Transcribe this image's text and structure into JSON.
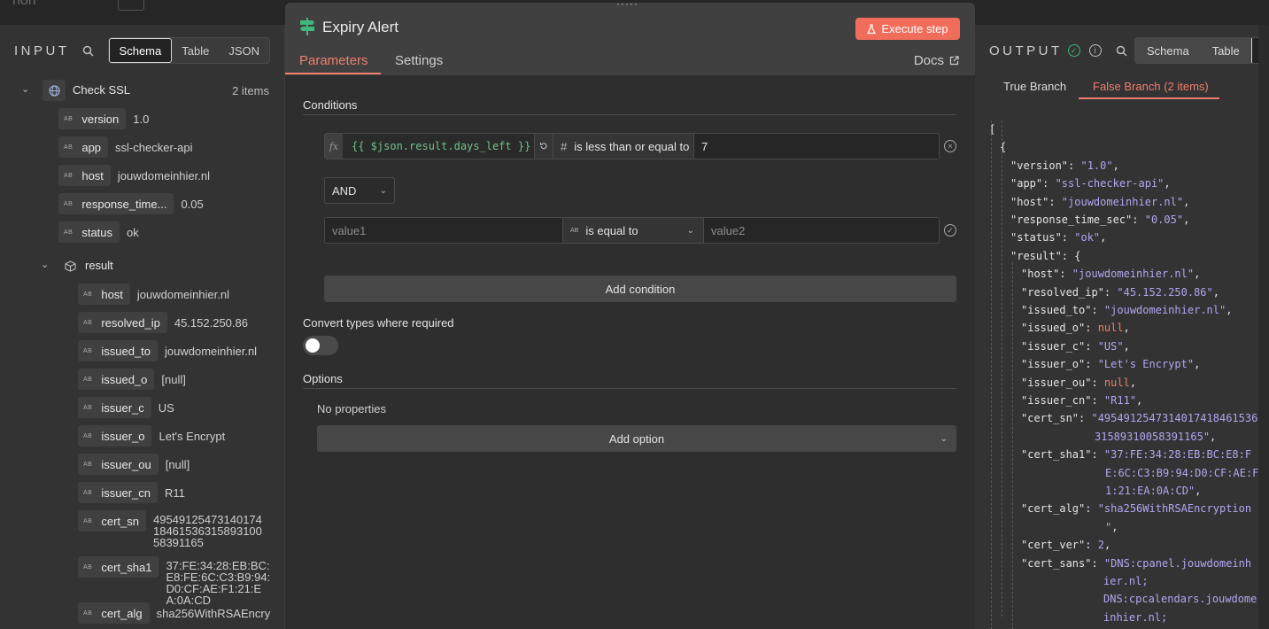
{
  "background": {
    "node_label": "non"
  },
  "input": {
    "label": "INPUT",
    "view_tabs": [
      "Schema",
      "Table",
      "JSON"
    ],
    "active_view": "Schema",
    "root": {
      "label": "Check SSL",
      "count": "2 items"
    },
    "fields": [
      {
        "key": "version",
        "value": "1.0"
      },
      {
        "key": "app",
        "value": "ssl-checker-api"
      },
      {
        "key": "host",
        "value": "jouwdomeinhier.nl"
      },
      {
        "key": "response_time...",
        "value": "0.05"
      },
      {
        "key": "status",
        "value": "ok"
      }
    ],
    "result": {
      "label": "result",
      "fields": [
        {
          "key": "host",
          "value": "jouwdomeinhier.nl"
        },
        {
          "key": "resolved_ip",
          "value": "45.152.250.86"
        },
        {
          "key": "issued_to",
          "value": "jouwdomeinhier.nl"
        },
        {
          "key": "issued_o",
          "value": "[null]"
        },
        {
          "key": "issuer_c",
          "value": "US"
        },
        {
          "key": "issuer_o",
          "value": "Let's Encrypt"
        },
        {
          "key": "issuer_ou",
          "value": "[null]"
        },
        {
          "key": "issuer_cn",
          "value": "R11"
        },
        {
          "key": "cert_sn",
          "value": "495491254731401741846153631589310058391165"
        },
        {
          "key": "cert_sha1",
          "value": "37:FE:34:28:EB:BC:E8:FE:6C:C3:B9:94:D0:CF:AE:F1:21:EA:0A:CD"
        },
        {
          "key": "cert_alg",
          "value": "sha256WithRSAEncry"
        }
      ]
    }
  },
  "modal": {
    "title": "Expiry Alert",
    "execute_label": "Execute step",
    "tabs": [
      "Parameters",
      "Settings"
    ],
    "docs_label": "Docs",
    "conditions_label": "Conditions",
    "condition1": {
      "fx": "fx",
      "expression": "{{ $json.result.days_left }}",
      "operator": "is less than or equal to",
      "value": "7"
    },
    "combinator": "AND",
    "condition2": {
      "value1_placeholder": "value1",
      "operator": "is equal to",
      "value2_placeholder": "value2"
    },
    "add_condition_label": "Add condition",
    "convert_types_label": "Convert types where required",
    "options_label": "Options",
    "no_properties": "No properties",
    "add_option_label": "Add option"
  },
  "output": {
    "label": "OUTPUT",
    "view_tabs": [
      "Schema",
      "Table"
    ],
    "branches": [
      "True Branch",
      "False Branch (2 items)"
    ],
    "active_branch": "False Branch (2 items)",
    "json_lines": [
      {
        "indent": 0,
        "parts": [
          [
            "p",
            "["
          ]
        ]
      },
      {
        "indent": 1,
        "parts": [
          [
            "p",
            "{"
          ]
        ]
      },
      {
        "indent": 2,
        "parts": [
          [
            "k",
            "\"version\": "
          ],
          [
            "s",
            "\"1.0\""
          ],
          [
            "p",
            ","
          ]
        ]
      },
      {
        "indent": 2,
        "parts": [
          [
            "k",
            "\"app\": "
          ],
          [
            "s",
            "\"ssl-checker-api\""
          ],
          [
            "p",
            ","
          ]
        ]
      },
      {
        "indent": 2,
        "parts": [
          [
            "k",
            "\"host\": "
          ],
          [
            "s",
            "\"jouwdomeinhier.nl\""
          ],
          [
            "p",
            ","
          ]
        ]
      },
      {
        "indent": 2,
        "parts": [
          [
            "k",
            "\"response_time_sec\": "
          ],
          [
            "s",
            "\"0.05\""
          ],
          [
            "p",
            ","
          ]
        ]
      },
      {
        "indent": 2,
        "parts": [
          [
            "k",
            "\"status\": "
          ],
          [
            "s",
            "\"ok\""
          ],
          [
            "p",
            ","
          ]
        ]
      },
      {
        "indent": 2,
        "parts": [
          [
            "k",
            "\"result\": "
          ],
          [
            "p",
            "{"
          ]
        ]
      },
      {
        "indent": 3,
        "parts": [
          [
            "k",
            "\"host\": "
          ],
          [
            "s",
            "\"jouwdomeinhier.nl\""
          ],
          [
            "p",
            ","
          ]
        ]
      },
      {
        "indent": 3,
        "parts": [
          [
            "k",
            "\"resolved_ip\": "
          ],
          [
            "s",
            "\"45.152.250.86\""
          ],
          [
            "p",
            ","
          ]
        ]
      },
      {
        "indent": 3,
        "parts": [
          [
            "k",
            "\"issued_to\": "
          ],
          [
            "s",
            "\"jouwdomeinhier.nl\""
          ],
          [
            "p",
            ","
          ]
        ]
      },
      {
        "indent": 3,
        "parts": [
          [
            "k",
            "\"issued_o\": "
          ],
          [
            "n",
            "null"
          ],
          [
            "p",
            ","
          ]
        ]
      },
      {
        "indent": 3,
        "parts": [
          [
            "k",
            "\"issuer_c\": "
          ],
          [
            "s",
            "\"US\""
          ],
          [
            "p",
            ","
          ]
        ]
      },
      {
        "indent": 3,
        "parts": [
          [
            "k",
            "\"issuer_o\": "
          ],
          [
            "s",
            "\"Let's Encrypt\""
          ],
          [
            "p",
            ","
          ]
        ]
      },
      {
        "indent": 3,
        "parts": [
          [
            "k",
            "\"issuer_ou\": "
          ],
          [
            "n",
            "null"
          ],
          [
            "p",
            ","
          ]
        ]
      },
      {
        "indent": 3,
        "parts": [
          [
            "k",
            "\"issuer_cn\": "
          ],
          [
            "s",
            "\"R11\""
          ],
          [
            "p",
            ","
          ]
        ]
      },
      {
        "indent": 3,
        "parts": [
          [
            "k",
            "\"cert_sn\": "
          ],
          [
            "s",
            "\"4954912547314017418461536"
          ]
        ]
      },
      {
        "indent": 3,
        "cont": true,
        "parts": [
          [
            "s",
            "31589310058391165\""
          ],
          [
            "p",
            ","
          ]
        ]
      },
      {
        "indent": 3,
        "parts": [
          [
            "k",
            "\"cert_sha1\": "
          ],
          [
            "s",
            "\"37:FE:34:28:EB:BC:E8:F"
          ]
        ]
      },
      {
        "indent": 3,
        "cont2": true,
        "parts": [
          [
            "s",
            "E:6C:C3:B9:94:D0:CF:AE:F"
          ]
        ]
      },
      {
        "indent": 3,
        "cont2": true,
        "parts": [
          [
            "s",
            "1:21:EA:0A:CD\""
          ],
          [
            "p",
            ","
          ]
        ]
      },
      {
        "indent": 3,
        "parts": [
          [
            "k",
            "\"cert_alg\": "
          ],
          [
            "s",
            "\"sha256WithRSAEncryption"
          ]
        ]
      },
      {
        "indent": 3,
        "cont2": true,
        "parts": [
          [
            "s",
            "\""
          ],
          [
            "p",
            ","
          ]
        ]
      },
      {
        "indent": 3,
        "parts": [
          [
            "k",
            "\"cert_ver\": "
          ],
          [
            "num",
            "2"
          ],
          [
            "p",
            ","
          ]
        ]
      },
      {
        "indent": 3,
        "parts": [
          [
            "k",
            "\"cert_sans\": "
          ],
          [
            "s",
            "\"DNS:cpanel.jouwdomeinh"
          ]
        ]
      },
      {
        "indent": 3,
        "cont3": true,
        "parts": [
          [
            "s",
            "ier.nl;"
          ]
        ]
      },
      {
        "indent": 3,
        "cont3": true,
        "parts": [
          [
            "s",
            "DNS:cpcalendars.jouwdome"
          ]
        ]
      },
      {
        "indent": 3,
        "cont3": true,
        "parts": [
          [
            "s",
            "inhier.nl;"
          ]
        ]
      }
    ]
  },
  "colors": {
    "accent": "#ef7e6e",
    "execute": "#ef6d5a",
    "success": "#3fb67a",
    "expr": "#6ec48a",
    "json_string": "#b3a6f0"
  }
}
